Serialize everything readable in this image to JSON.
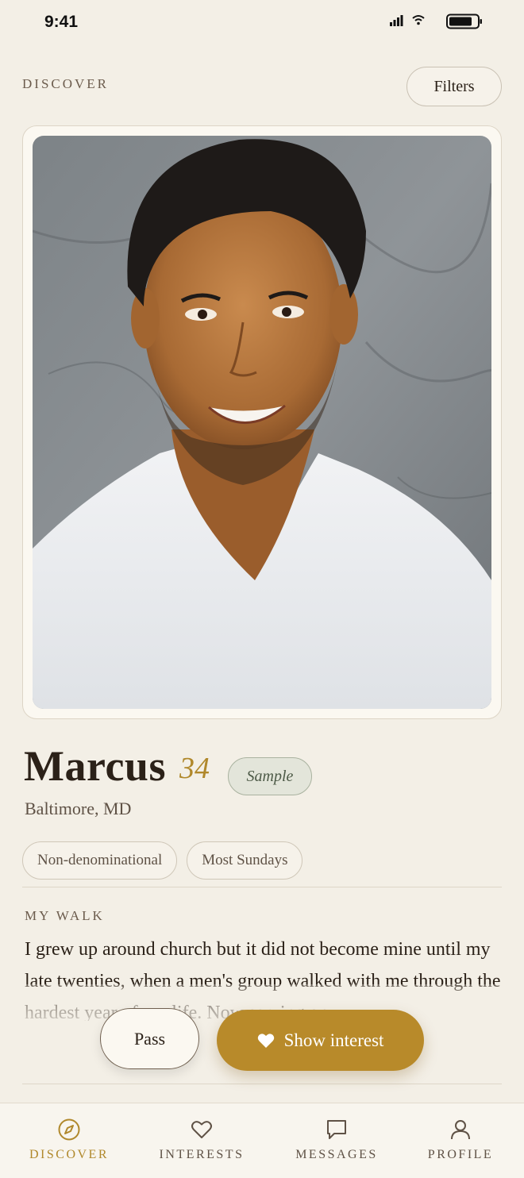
{
  "status_bar": {
    "time": "9:41"
  },
  "header": {
    "title": "DISCOVER",
    "filters_label": "Filters"
  },
  "profile": {
    "name": "Marcus",
    "age": "34",
    "badge": "Sample",
    "location": "Baltimore, MD",
    "tags": [
      "Non-denominational",
      "Most Sundays"
    ],
    "section_heading": "MY WALK",
    "walk_text": "I grew up around church but it did not become mine until my late twenties, when a men's group walked with me through the hardest year of my life. Now serving on"
  },
  "actions": {
    "pass_label": "Pass",
    "interest_label": "Show interest"
  },
  "tabs": [
    {
      "label": "DISCOVER",
      "icon": "compass-icon",
      "active": true
    },
    {
      "label": "INTERESTS",
      "icon": "heart-outline-icon",
      "active": false
    },
    {
      "label": "MESSAGES",
      "icon": "chat-bubble-icon",
      "active": false
    },
    {
      "label": "PROFILE",
      "icon": "person-icon",
      "active": false
    }
  ],
  "colors": {
    "accent": "#b88a2a",
    "background": "#f3efe6",
    "sage": "#a9b29f"
  }
}
